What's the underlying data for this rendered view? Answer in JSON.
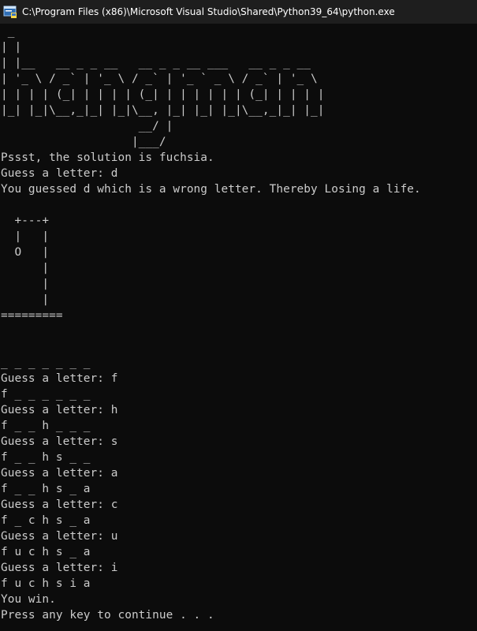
{
  "window": {
    "title": "C:\\Program Files (x86)\\Microsoft Visual Studio\\Shared\\Python39_64\\python.exe",
    "icon": "python-console-icon"
  },
  "console": {
    "banner": " _\n| |\n| |__   __ _ _ __   __ _ _ __ ___   __ _ _ __\n| '_ \\ / _` | '_ \\ / _` | '_ ` _ \\ / _` | '_ \\\n| | | | (_| | | | | (_| | | | | | | (_| | | | |\n|_| |_|\\__,_|_| |_|\\__, |_| |_| |_|\\__,_|_| |_|\n                    __/ |\n                   |___/",
    "transcript": "Pssst, the solution is fuchsia.\nGuess a letter: d\nYou guessed d which is a wrong letter. Thereby Losing a life.\n\n  +---+\n  |   |\n  O   |\n      |\n      |\n      |\n=========\n\n\n_ _ _ _ _ _ _\nGuess a letter: f\nf _ _ _ _ _ _\nGuess a letter: h\nf _ _ h _ _ _\nGuess a letter: s\nf _ _ h s _ _\nGuess a letter: a\nf _ _ h s _ a\nGuess a letter: c\nf _ c h s _ a\nGuess a letter: u\nf u c h s _ a\nGuess a letter: i\nf u c h s i a\nYou win.\nPress any key to continue . . ."
  }
}
